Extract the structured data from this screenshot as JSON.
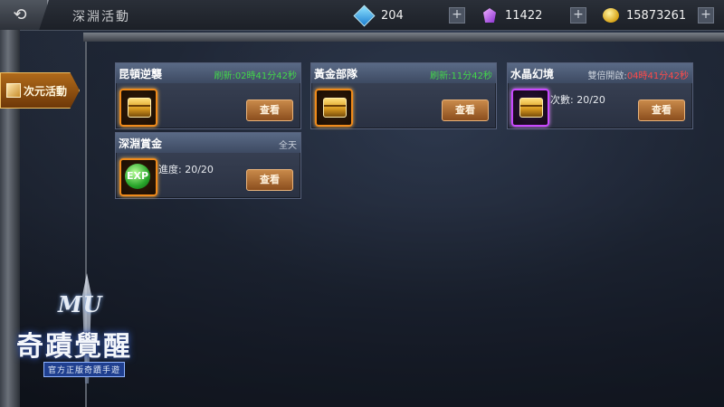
{
  "header": {
    "back_icon": "back-arrow-icon",
    "title": "深淵活動",
    "currencies": [
      {
        "icon": "diamond-icon",
        "value": "204"
      },
      {
        "icon": "purple-gem-icon",
        "value": "11422"
      },
      {
        "icon": "gold-coin-icon",
        "value": "15873261"
      }
    ],
    "add_symbol": "+"
  },
  "sidebar": {
    "tab_label": "次元活動",
    "tab_icon": "book-icon"
  },
  "cards": [
    {
      "title": "昆頓逆襲",
      "status": "刷新:02時41分42秒",
      "status_color": "#43d64a",
      "item": "golden-chest-icon",
      "progress": "",
      "button": "查看"
    },
    {
      "title": "黃金部隊",
      "status": "刷新:11分42秒",
      "status_color": "#43d64a",
      "item": "golden-chest-icon",
      "progress": "",
      "button": "查看"
    },
    {
      "title": "水晶幻境",
      "status_prefix": "雙倍開啟:",
      "status": "04時41分42秒",
      "status_color": "#ff4a4a",
      "item": "purple-chest-icon",
      "progress": "次數:  20/20",
      "button": "查看"
    },
    {
      "title": "深淵賞金",
      "status": "全天",
      "status_color": "#c9d0da",
      "item": "exp-orb-icon",
      "item_text": "EXP",
      "progress": "進度:  20/20",
      "button": "查看"
    }
  ],
  "logo": {
    "mu": "MU",
    "name": "奇蹟覺醒",
    "subtitle": "官方正版奇蹟手遊"
  }
}
